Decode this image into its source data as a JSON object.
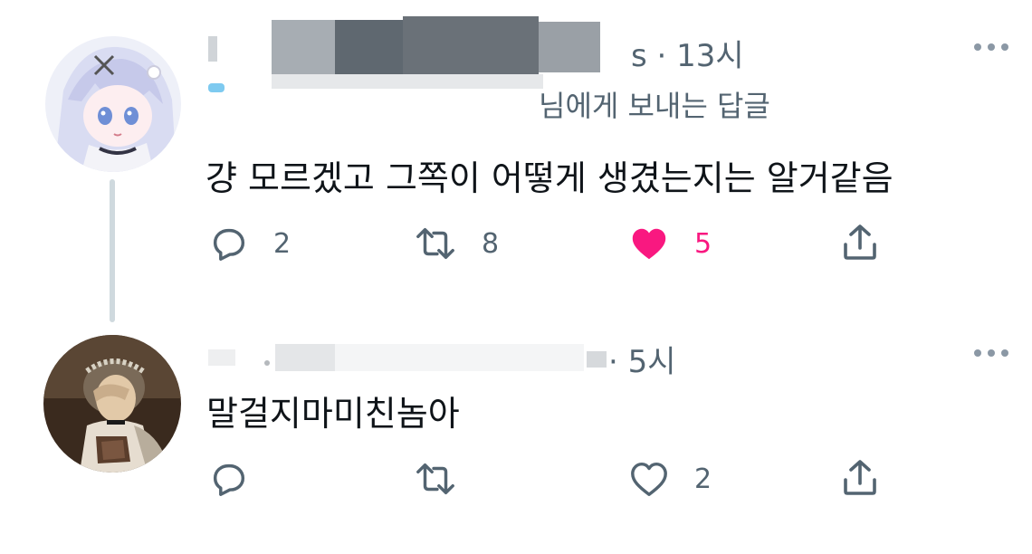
{
  "tweets": [
    {
      "meta_suffix": "s · 13시",
      "reply_to": "님에게 보내는 답글",
      "text": "걍 모르겠고 그쪽이 어떻게 생겼는지는 알거같음",
      "replies": "2",
      "retweets": "8",
      "likes": "5",
      "liked": true,
      "accent": "#f91880",
      "icons": [
        "reply-icon",
        "retweet-icon",
        "heart-filled-icon",
        "share-icon",
        "more-icon"
      ]
    },
    {
      "meta_suffix": "· 5시",
      "text": "말걸지마미친놈아",
      "replies": "",
      "retweets": "",
      "likes": "2",
      "liked": false,
      "icons": [
        "reply-icon",
        "retweet-icon",
        "heart-outline-icon",
        "share-icon",
        "more-icon"
      ]
    }
  ]
}
